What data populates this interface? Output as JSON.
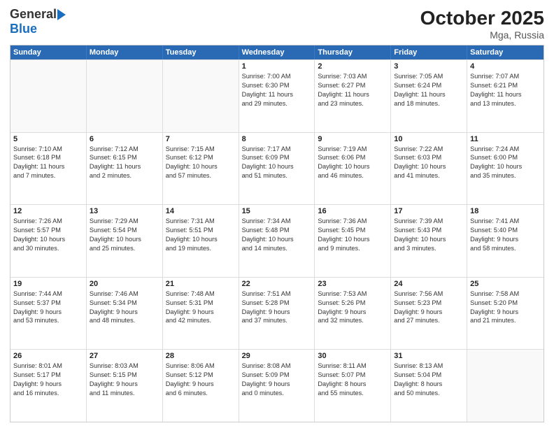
{
  "logo": {
    "general": "General",
    "blue": "Blue"
  },
  "header": {
    "month": "October 2025",
    "location": "Mga, Russia"
  },
  "days_of_week": [
    "Sunday",
    "Monday",
    "Tuesday",
    "Wednesday",
    "Thursday",
    "Friday",
    "Saturday"
  ],
  "rows": [
    [
      {
        "day": "",
        "empty": true
      },
      {
        "day": "",
        "empty": true
      },
      {
        "day": "",
        "empty": true
      },
      {
        "day": "1",
        "lines": [
          "Sunrise: 7:00 AM",
          "Sunset: 6:30 PM",
          "Daylight: 11 hours",
          "and 29 minutes."
        ]
      },
      {
        "day": "2",
        "lines": [
          "Sunrise: 7:03 AM",
          "Sunset: 6:27 PM",
          "Daylight: 11 hours",
          "and 23 minutes."
        ]
      },
      {
        "day": "3",
        "lines": [
          "Sunrise: 7:05 AM",
          "Sunset: 6:24 PM",
          "Daylight: 11 hours",
          "and 18 minutes."
        ]
      },
      {
        "day": "4",
        "lines": [
          "Sunrise: 7:07 AM",
          "Sunset: 6:21 PM",
          "Daylight: 11 hours",
          "and 13 minutes."
        ]
      }
    ],
    [
      {
        "day": "5",
        "lines": [
          "Sunrise: 7:10 AM",
          "Sunset: 6:18 PM",
          "Daylight: 11 hours",
          "and 7 minutes."
        ]
      },
      {
        "day": "6",
        "lines": [
          "Sunrise: 7:12 AM",
          "Sunset: 6:15 PM",
          "Daylight: 11 hours",
          "and 2 minutes."
        ]
      },
      {
        "day": "7",
        "lines": [
          "Sunrise: 7:15 AM",
          "Sunset: 6:12 PM",
          "Daylight: 10 hours",
          "and 57 minutes."
        ]
      },
      {
        "day": "8",
        "lines": [
          "Sunrise: 7:17 AM",
          "Sunset: 6:09 PM",
          "Daylight: 10 hours",
          "and 51 minutes."
        ]
      },
      {
        "day": "9",
        "lines": [
          "Sunrise: 7:19 AM",
          "Sunset: 6:06 PM",
          "Daylight: 10 hours",
          "and 46 minutes."
        ]
      },
      {
        "day": "10",
        "lines": [
          "Sunrise: 7:22 AM",
          "Sunset: 6:03 PM",
          "Daylight: 10 hours",
          "and 41 minutes."
        ]
      },
      {
        "day": "11",
        "lines": [
          "Sunrise: 7:24 AM",
          "Sunset: 6:00 PM",
          "Daylight: 10 hours",
          "and 35 minutes."
        ]
      }
    ],
    [
      {
        "day": "12",
        "lines": [
          "Sunrise: 7:26 AM",
          "Sunset: 5:57 PM",
          "Daylight: 10 hours",
          "and 30 minutes."
        ]
      },
      {
        "day": "13",
        "lines": [
          "Sunrise: 7:29 AM",
          "Sunset: 5:54 PM",
          "Daylight: 10 hours",
          "and 25 minutes."
        ]
      },
      {
        "day": "14",
        "lines": [
          "Sunrise: 7:31 AM",
          "Sunset: 5:51 PM",
          "Daylight: 10 hours",
          "and 19 minutes."
        ]
      },
      {
        "day": "15",
        "lines": [
          "Sunrise: 7:34 AM",
          "Sunset: 5:48 PM",
          "Daylight: 10 hours",
          "and 14 minutes."
        ]
      },
      {
        "day": "16",
        "lines": [
          "Sunrise: 7:36 AM",
          "Sunset: 5:45 PM",
          "Daylight: 10 hours",
          "and 9 minutes."
        ]
      },
      {
        "day": "17",
        "lines": [
          "Sunrise: 7:39 AM",
          "Sunset: 5:43 PM",
          "Daylight: 10 hours",
          "and 3 minutes."
        ]
      },
      {
        "day": "18",
        "lines": [
          "Sunrise: 7:41 AM",
          "Sunset: 5:40 PM",
          "Daylight: 9 hours",
          "and 58 minutes."
        ]
      }
    ],
    [
      {
        "day": "19",
        "lines": [
          "Sunrise: 7:44 AM",
          "Sunset: 5:37 PM",
          "Daylight: 9 hours",
          "and 53 minutes."
        ]
      },
      {
        "day": "20",
        "lines": [
          "Sunrise: 7:46 AM",
          "Sunset: 5:34 PM",
          "Daylight: 9 hours",
          "and 48 minutes."
        ]
      },
      {
        "day": "21",
        "lines": [
          "Sunrise: 7:48 AM",
          "Sunset: 5:31 PM",
          "Daylight: 9 hours",
          "and 42 minutes."
        ]
      },
      {
        "day": "22",
        "lines": [
          "Sunrise: 7:51 AM",
          "Sunset: 5:28 PM",
          "Daylight: 9 hours",
          "and 37 minutes."
        ]
      },
      {
        "day": "23",
        "lines": [
          "Sunrise: 7:53 AM",
          "Sunset: 5:26 PM",
          "Daylight: 9 hours",
          "and 32 minutes."
        ]
      },
      {
        "day": "24",
        "lines": [
          "Sunrise: 7:56 AM",
          "Sunset: 5:23 PM",
          "Daylight: 9 hours",
          "and 27 minutes."
        ]
      },
      {
        "day": "25",
        "lines": [
          "Sunrise: 7:58 AM",
          "Sunset: 5:20 PM",
          "Daylight: 9 hours",
          "and 21 minutes."
        ]
      }
    ],
    [
      {
        "day": "26",
        "lines": [
          "Sunrise: 8:01 AM",
          "Sunset: 5:17 PM",
          "Daylight: 9 hours",
          "and 16 minutes."
        ]
      },
      {
        "day": "27",
        "lines": [
          "Sunrise: 8:03 AM",
          "Sunset: 5:15 PM",
          "Daylight: 9 hours",
          "and 11 minutes."
        ]
      },
      {
        "day": "28",
        "lines": [
          "Sunrise: 8:06 AM",
          "Sunset: 5:12 PM",
          "Daylight: 9 hours",
          "and 6 minutes."
        ]
      },
      {
        "day": "29",
        "lines": [
          "Sunrise: 8:08 AM",
          "Sunset: 5:09 PM",
          "Daylight: 9 hours",
          "and 0 minutes."
        ]
      },
      {
        "day": "30",
        "lines": [
          "Sunrise: 8:11 AM",
          "Sunset: 5:07 PM",
          "Daylight: 8 hours",
          "and 55 minutes."
        ]
      },
      {
        "day": "31",
        "lines": [
          "Sunrise: 8:13 AM",
          "Sunset: 5:04 PM",
          "Daylight: 8 hours",
          "and 50 minutes."
        ]
      },
      {
        "day": "",
        "empty": true
      }
    ]
  ]
}
